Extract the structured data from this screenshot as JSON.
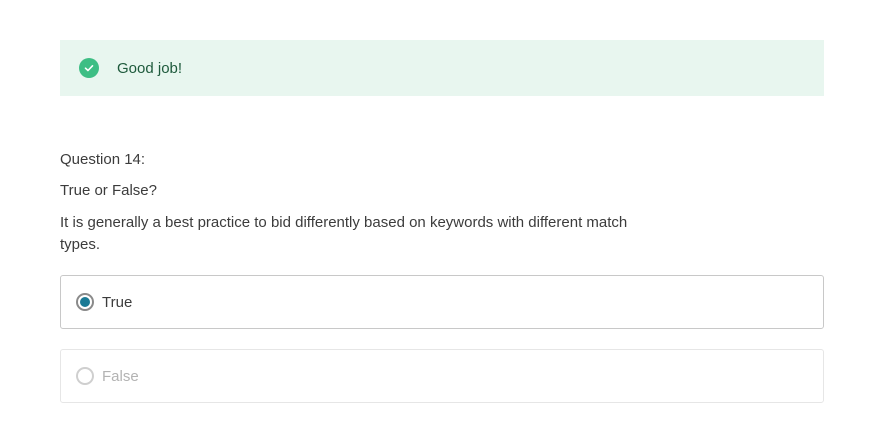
{
  "feedback": {
    "icon": "check-circle-icon",
    "message": "Good job!",
    "color": "#3dbe84",
    "background": "#e8f6ef"
  },
  "question": {
    "number_label": "Question 14:",
    "type_label": "True or False?",
    "text": "It is generally a best practice to bid differently based on keywords with different match types."
  },
  "options": [
    {
      "label": "True",
      "selected": true
    },
    {
      "label": "False",
      "selected": false
    }
  ],
  "accent_color": "#1a7a95"
}
